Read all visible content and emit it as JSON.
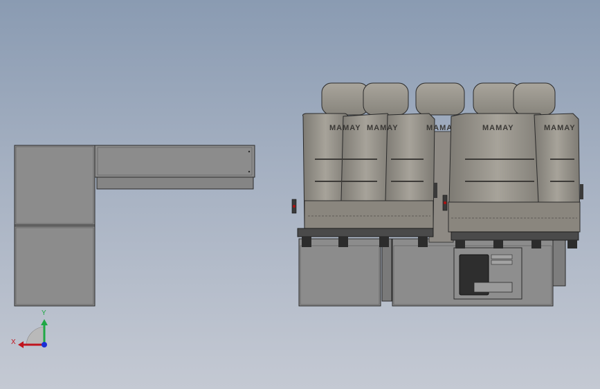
{
  "scene": {
    "seat_brand": "MAMAY",
    "colors": {
      "background_top": "#8a9bb2",
      "background_bottom": "#c4c9d3",
      "part_fill": "#8c8c8c",
      "part_edge": "#2a2a2a",
      "seat_fill": "#9a968d",
      "seat_dark": "#55534f",
      "axis_x": "#c0141e",
      "axis_y": "#1fa845",
      "axis_z": "#1a2fd6"
    }
  },
  "triad": {
    "x_label": "X",
    "y_label": "Y"
  }
}
